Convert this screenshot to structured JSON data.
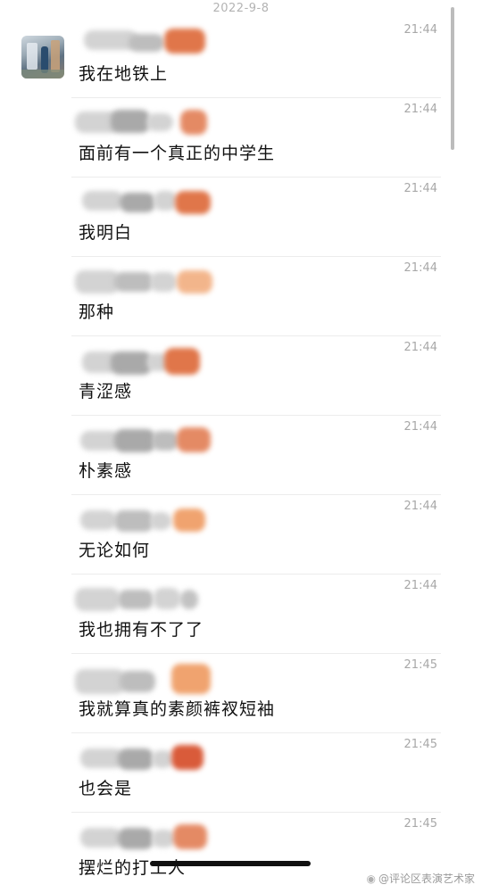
{
  "date_header": "2022-9-8",
  "messages": [
    {
      "time": "21:44",
      "text": "我在地铁上"
    },
    {
      "time": "21:44",
      "text": "面前有一个真正的中学生"
    },
    {
      "time": "21:44",
      "text": "我明白"
    },
    {
      "time": "21:44",
      "text": "那种"
    },
    {
      "time": "21:44",
      "text": "青涩感"
    },
    {
      "time": "21:44",
      "text": "朴素感"
    },
    {
      "time": "21:44",
      "text": "无论如何"
    },
    {
      "time": "21:44",
      "text": "我也拥有不了了"
    },
    {
      "time": "21:45",
      "text": "我就算真的素颜裤衩短袖"
    },
    {
      "time": "21:45",
      "text": "也会是"
    },
    {
      "time": "21:45",
      "text": "摆烂的打工人"
    }
  ],
  "watermark": {
    "logo_icon": "weibo-icon",
    "text": "@评论区表演艺术家"
  }
}
